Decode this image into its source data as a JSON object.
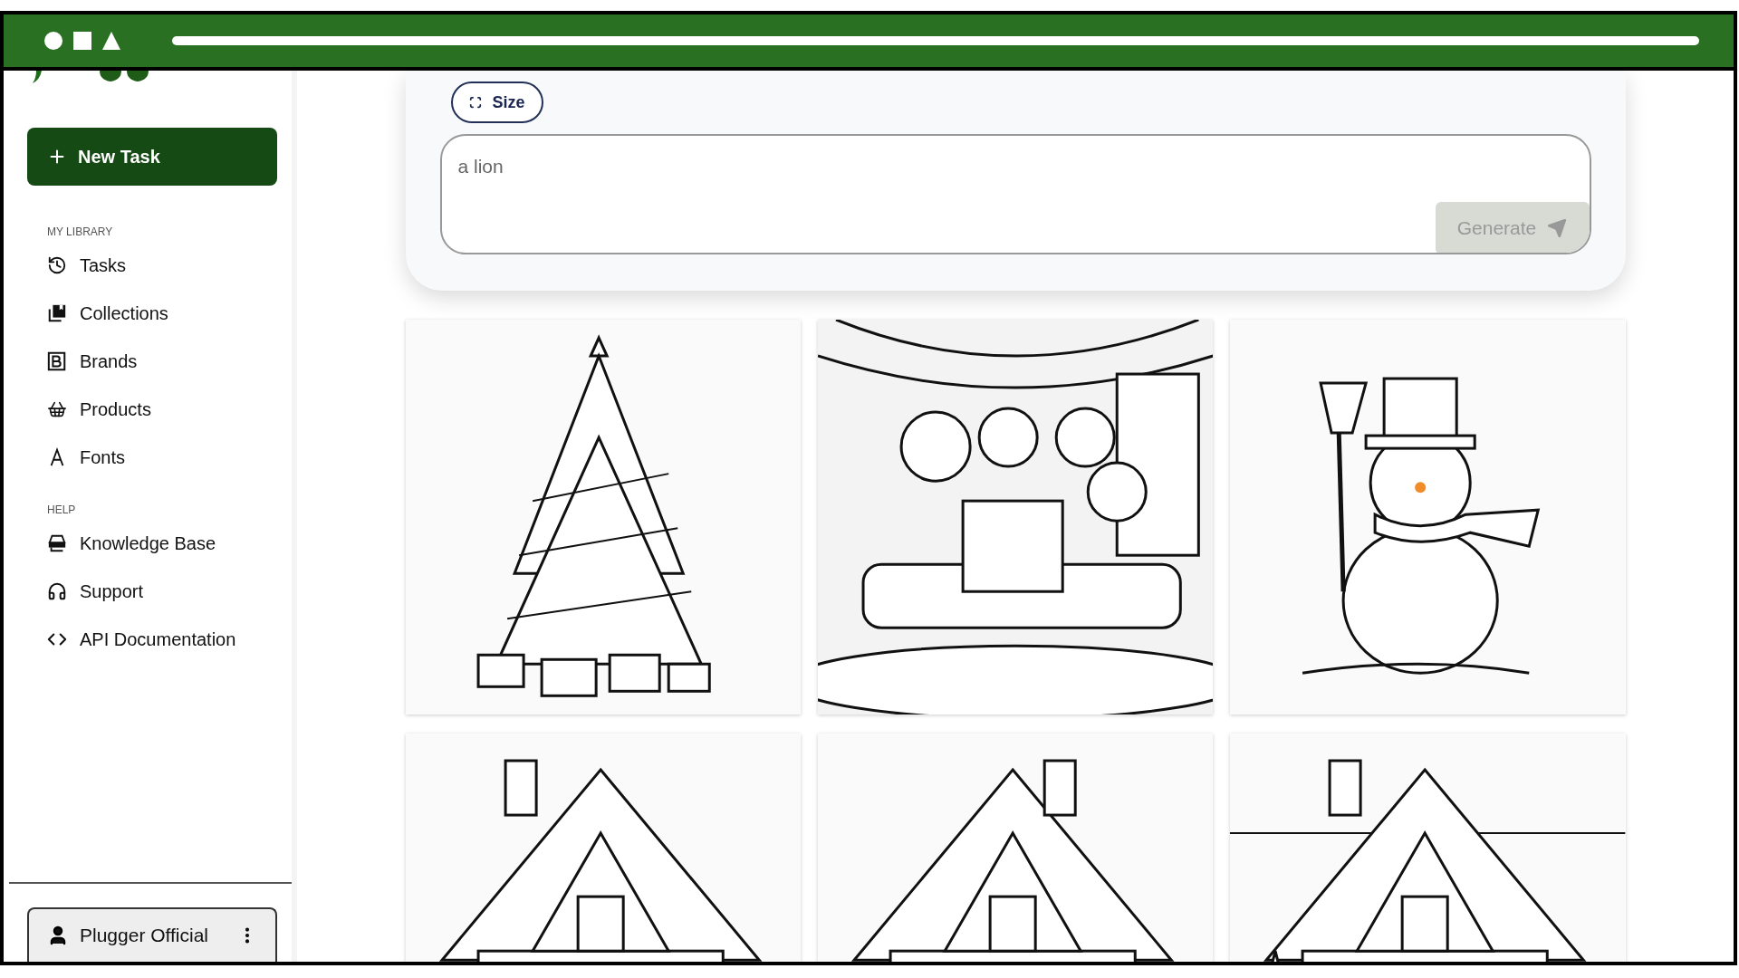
{
  "sidebar": {
    "new_task_button": "New Task",
    "sections": [
      {
        "heading": "MY LIBRARY",
        "items": [
          {
            "label": "Tasks"
          },
          {
            "label": "Collections"
          },
          {
            "label": "Brands"
          },
          {
            "label": "Products"
          },
          {
            "label": "Fonts"
          }
        ]
      },
      {
        "heading": "HELP",
        "items": [
          {
            "label": "Knowledge Base"
          },
          {
            "label": "Support"
          },
          {
            "label": "API Documentation"
          }
        ]
      }
    ],
    "user": {
      "name": "Plugger Official"
    }
  },
  "prompt": {
    "size_button": "Size",
    "placeholder": "a lion",
    "generate_button": {
      "label": "Generate",
      "disabled": true
    }
  }
}
